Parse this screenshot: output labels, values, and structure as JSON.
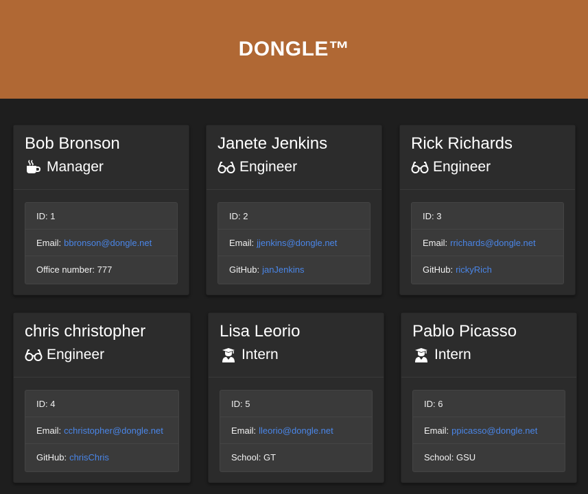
{
  "header": {
    "title": "DONGLE™"
  },
  "colors": {
    "header_bg": "#b06834",
    "page_bg": "#1e1e1e",
    "link": "#4a86e8"
  },
  "employees": [
    {
      "name": "Bob Bronson",
      "role": "Manager",
      "role_icon": "coffee-icon",
      "id_label": "ID: 1",
      "email_label": "Email:",
      "email": "bbronson@dongle.net",
      "extra_label": "Office number: 777",
      "extra_value": ""
    },
    {
      "name": "Janete Jenkins",
      "role": "Engineer",
      "role_icon": "glasses-icon",
      "id_label": "ID: 2",
      "email_label": "Email:",
      "email": "jjenkins@dongle.net",
      "extra_label": "GitHub:",
      "extra_value": "janJenkins"
    },
    {
      "name": "Rick Richards",
      "role": "Engineer",
      "role_icon": "glasses-icon",
      "id_label": "ID: 3",
      "email_label": "Email:",
      "email": "rrichards@dongle.net",
      "extra_label": "GitHub:",
      "extra_value": "rickyRich"
    },
    {
      "name": "chris christopher",
      "role": "Engineer",
      "role_icon": "glasses-icon",
      "id_label": "ID: 4",
      "email_label": "Email:",
      "email": "cchristopher@dongle.net",
      "extra_label": "GitHub:",
      "extra_value": "chrisChris"
    },
    {
      "name": "Lisa Leorio",
      "role": "Intern",
      "role_icon": "graduate-icon",
      "id_label": "ID: 5",
      "email_label": "Email:",
      "email": "lleorio@dongle.net",
      "extra_label": "School: GT",
      "extra_value": ""
    },
    {
      "name": "Pablo Picasso",
      "role": "Intern",
      "role_icon": "graduate-icon",
      "id_label": "ID: 6",
      "email_label": "Email:",
      "email": "ppicasso@dongle.net",
      "extra_label": "School: GSU",
      "extra_value": ""
    }
  ]
}
